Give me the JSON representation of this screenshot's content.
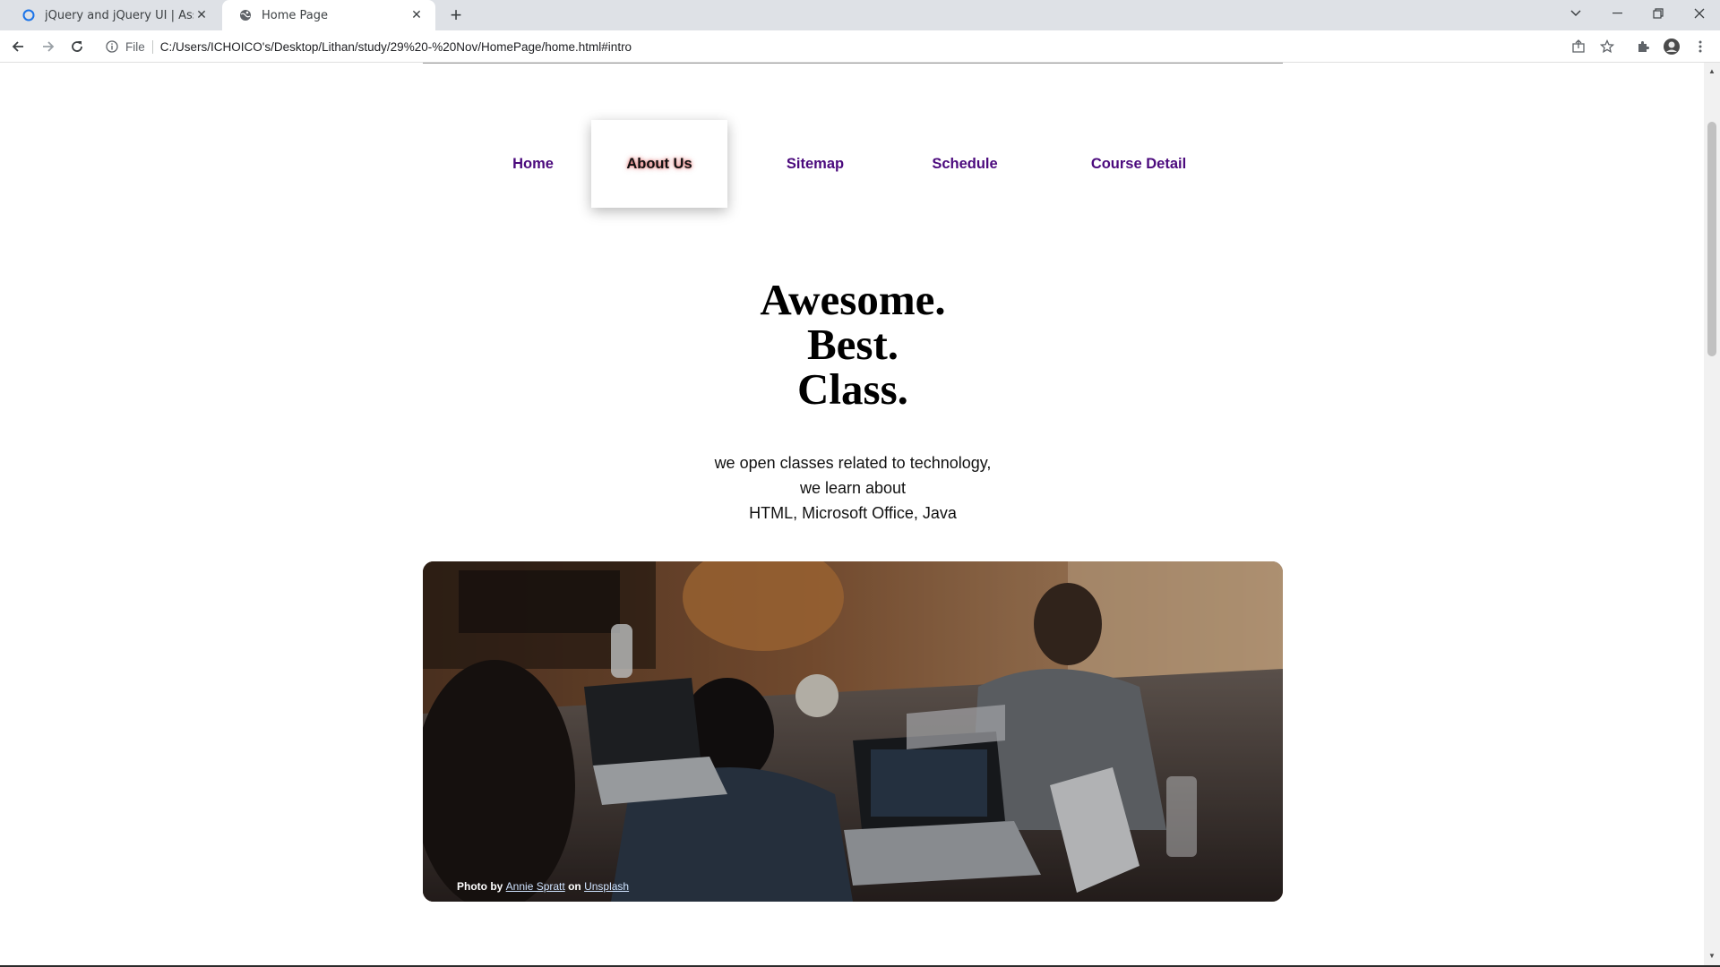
{
  "browser": {
    "tabs": [
      {
        "title": "jQuery and jQuery UI | Assignme",
        "active": false
      },
      {
        "title": "Home Page",
        "active": true
      }
    ],
    "scheme_label": "File",
    "url": "C:/Users/ICHOICO's/Desktop/Lithan/study/29%20-%20Nov/HomePage/home.html#intro"
  },
  "nav": {
    "items": [
      {
        "label": "Home",
        "active": false
      },
      {
        "label": "About Us",
        "active": true
      },
      {
        "label": "Sitemap",
        "active": false
      },
      {
        "label": "Schedule",
        "active": false
      },
      {
        "label": "Course Detail",
        "active": false
      }
    ]
  },
  "headline": {
    "lines": [
      "Awesome.",
      "Best.",
      "Class."
    ]
  },
  "intro": {
    "lines": [
      "we open classes related to technology,",
      "we learn about",
      "HTML, Microsoft Office, Java"
    ]
  },
  "hero": {
    "credit_prefix": "Photo by",
    "author": "Annie Spratt",
    "credit_middle": "on",
    "site": "Unsplash"
  },
  "colors": {
    "nav_link": "#4b0a7d",
    "accent_glow": "#c80000"
  }
}
